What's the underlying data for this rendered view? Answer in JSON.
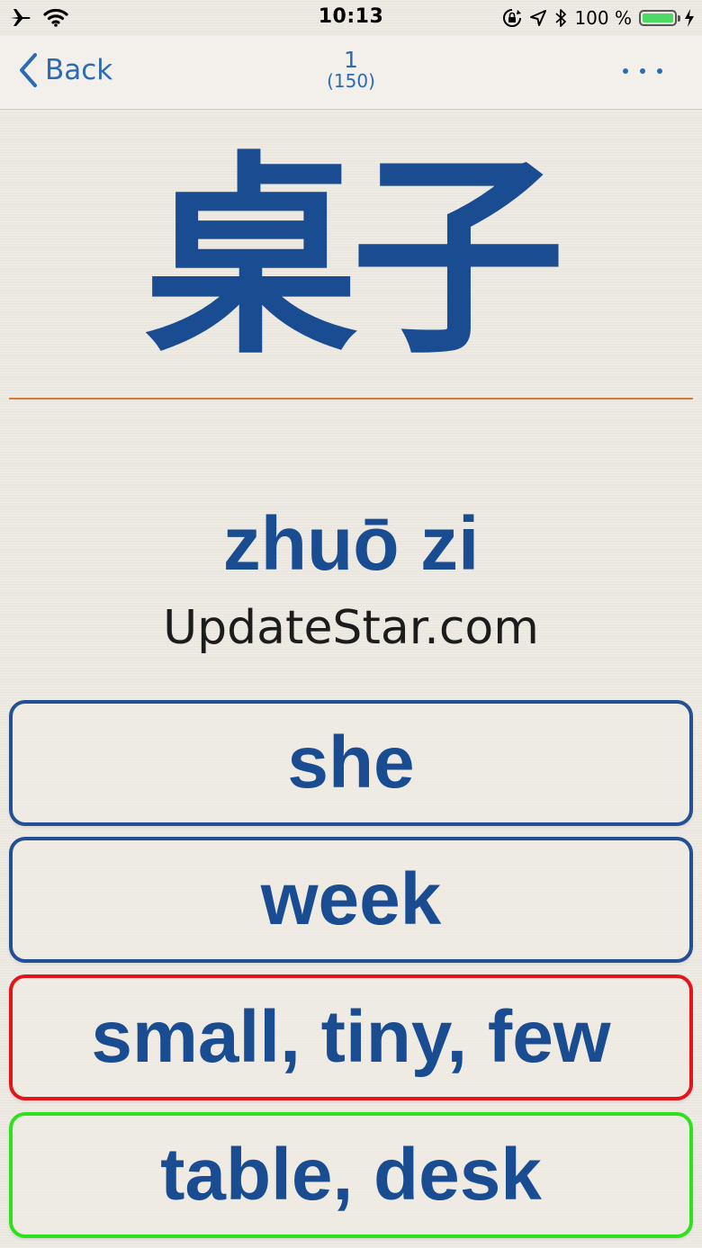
{
  "status_bar": {
    "time": "10:13",
    "battery_percent": "100 %",
    "battery_level": 1.0,
    "icons": [
      "airplane-icon",
      "wifi-icon",
      "orientation-lock-icon",
      "location-icon",
      "bluetooth-icon",
      "battery-icon",
      "charging-icon"
    ]
  },
  "nav": {
    "back_label": "Back",
    "card_index": "1",
    "card_total": "(150)"
  },
  "card": {
    "hanzi": "桌子",
    "pinyin": "zhuō zi",
    "watermark": "UpdateStar.com"
  },
  "answers": [
    {
      "label": "she",
      "state": "neutral"
    },
    {
      "label": "week",
      "state": "neutral"
    },
    {
      "label": "small, tiny, few",
      "state": "wrong"
    },
    {
      "label": "table, desk",
      "state": "correct"
    }
  ],
  "colors": {
    "accent": "#2c6bb2",
    "hanzi": "#1a4c92",
    "divider": "#e07a2f",
    "wrong": "#e3151b",
    "correct": "#2ee11d",
    "neutral_border": "#234f95",
    "battery": "#4cd964"
  }
}
